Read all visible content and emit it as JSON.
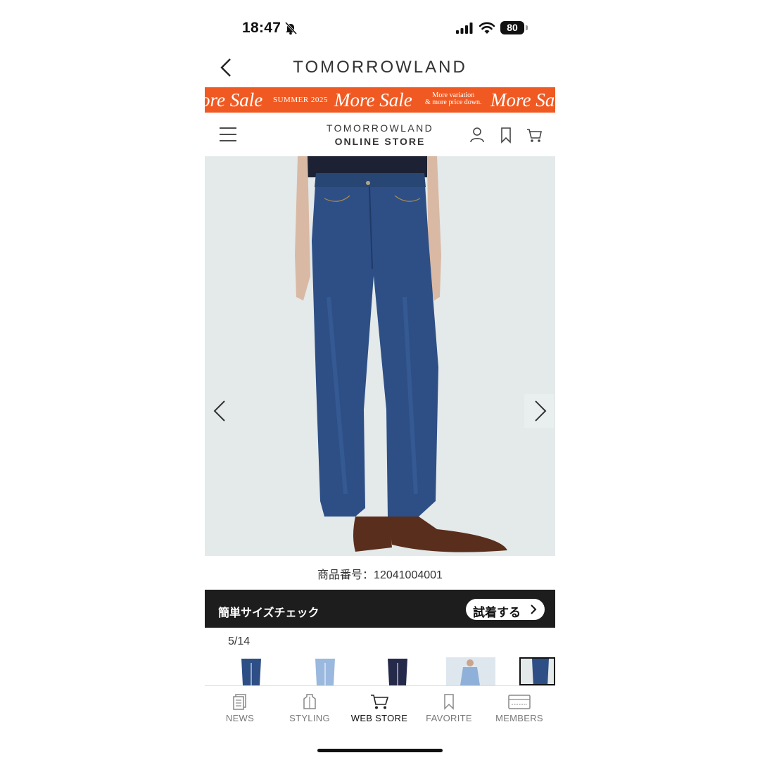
{
  "status_bar": {
    "time": "18:47",
    "battery": "80",
    "icons": [
      "bell-slash-icon",
      "signal-icon",
      "wifi-icon",
      "battery-icon"
    ]
  },
  "app_header": {
    "brand": "TOMORROWLAND",
    "back_icon": "chevron-left-icon"
  },
  "sale_banner": {
    "color": "#f05a22",
    "more_sale": "More Sale",
    "more_sale_left": "ore Sale",
    "more_sale_right": "More Sa",
    "season": "SUMMER 2025",
    "tagline_1": "More variation",
    "tagline_2": "& more price down."
  },
  "store_header": {
    "logo_line1": "TOMORROWLAND",
    "logo_line2": "ONLINE STORE",
    "icons": [
      "menu-icon",
      "account-icon",
      "bookmark-icon",
      "cart-icon"
    ]
  },
  "product": {
    "image": "model-wearing-wide-denim-jeans",
    "number_label": "商品番号：12041004001"
  },
  "size_check": {
    "label": "簡単サイズチェック",
    "button": "試着する"
  },
  "gallery": {
    "counter": "5/14"
  },
  "bottom_nav": {
    "items": [
      {
        "label": "NEWS",
        "icon": "news-icon"
      },
      {
        "label": "STYLING",
        "icon": "styling-icon"
      },
      {
        "label": "WEB STORE",
        "icon": "cart-icon",
        "active": true
      },
      {
        "label": "FAVORITE",
        "icon": "bookmark-icon"
      },
      {
        "label": "MEMBERS",
        "icon": "member-card-icon"
      }
    ]
  },
  "colors": {
    "accent": "#f05a22",
    "dark_bar": "#1d1d1d",
    "denim": "#2d4f86",
    "background_image": "#e4e9ea"
  }
}
